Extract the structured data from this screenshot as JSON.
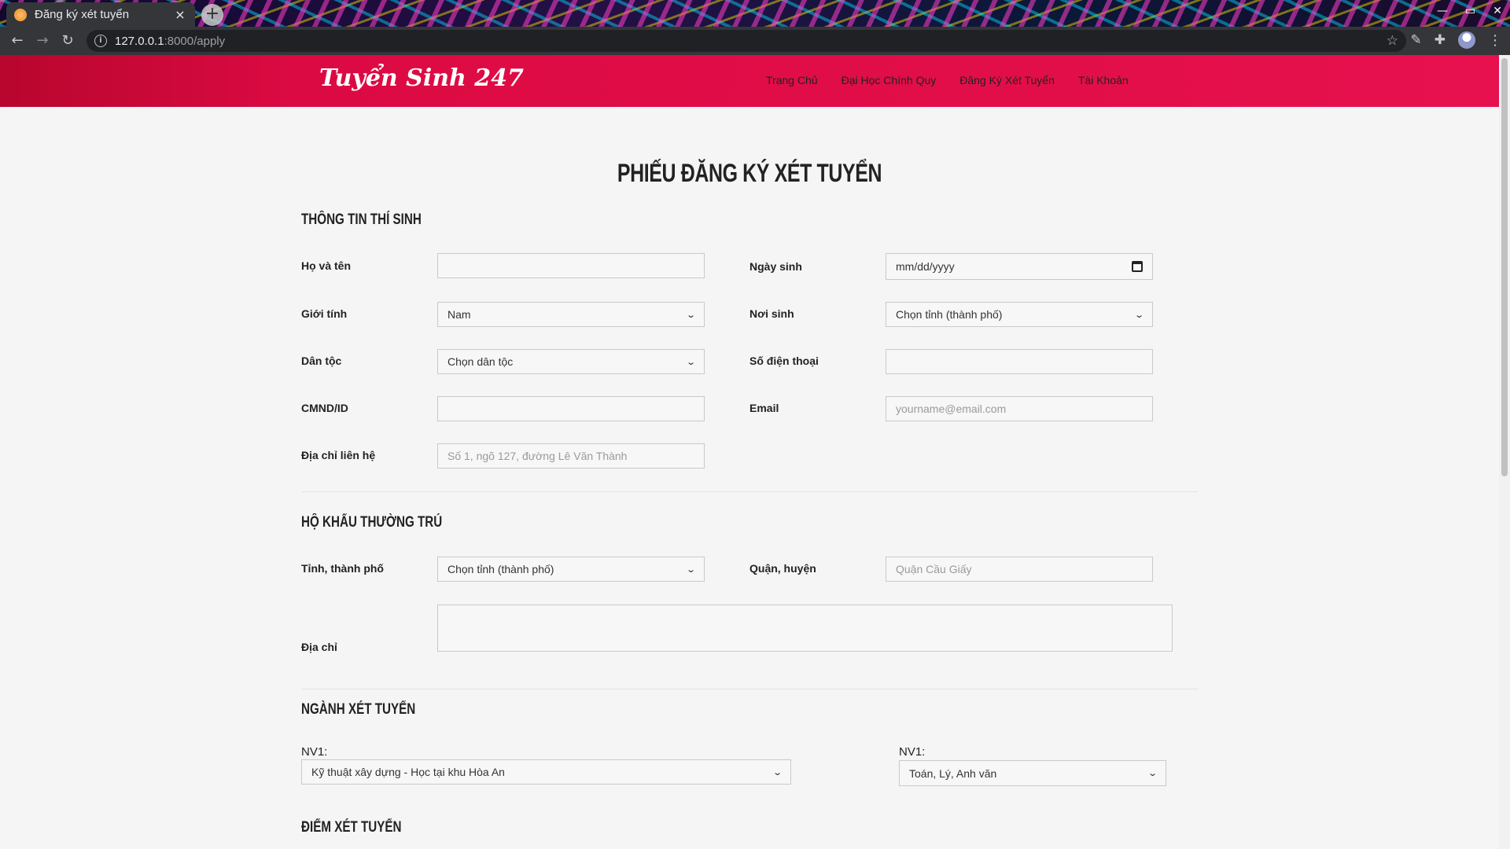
{
  "browser": {
    "tab_title": "Đăng ký xét tuyển",
    "tab_close": "×",
    "new_tab": "+",
    "url_host": "127.0.0.1",
    "url_rest": ":8000/apply",
    "window_controls": [
      "—",
      "▭",
      "✕"
    ]
  },
  "site": {
    "logo": "Tuyển Sinh 247",
    "nav": [
      "Trang Chủ",
      "Đại Học Chính Quy",
      "Đăng Ký Xét Tuyển",
      "Tài Khoản"
    ]
  },
  "form": {
    "title": "PHIẾU ĐĂNG KÝ XÉT TUYỂN",
    "section_personal": "THÔNG TIN THÍ SINH",
    "section_residence": "HỘ KHẨU THƯỜNG TRÚ",
    "section_major": "NGÀNH XÉT TUYỂN",
    "section_score": "ĐIỂM XÉT TUYỂN",
    "fields": {
      "fullname_label": "Họ và tên",
      "fullname_value": "",
      "dob_label": "Ngày sinh",
      "dob_value": "mm/dd/yyyy",
      "gender_label": "Giới tính",
      "gender_value": "Nam",
      "birthplace_label": "Nơi sinh",
      "birthplace_value": "Chọn tỉnh (thành phố)",
      "ethnicity_label": "Dân tộc",
      "ethnicity_value": "Chọn dân tộc",
      "phone_label": "Số điện thoại",
      "phone_value": "",
      "id_label": "CMND/ID",
      "id_value": "",
      "email_label": "Email",
      "email_placeholder": "yourname@email.com",
      "address_label": "Địa chỉ liên hệ",
      "address_placeholder": "Số 1, ngõ 127, đường Lê Văn Thành",
      "province_label": "Tỉnh, thành phố",
      "province_value": "Chọn tỉnh (thành phố)",
      "district_label": "Quận, huyện",
      "district_placeholder": "Quận Cầu Giấy",
      "residence_address_label": "Địa chỉ",
      "nv1_label": "NV1:",
      "nv1_major_value": "Kỹ thuật xây dựng - Học tại khu Hòa An",
      "nv1_combo_label": "NV1:",
      "nv1_combo_value": "Toán, Lý, Anh văn"
    }
  }
}
